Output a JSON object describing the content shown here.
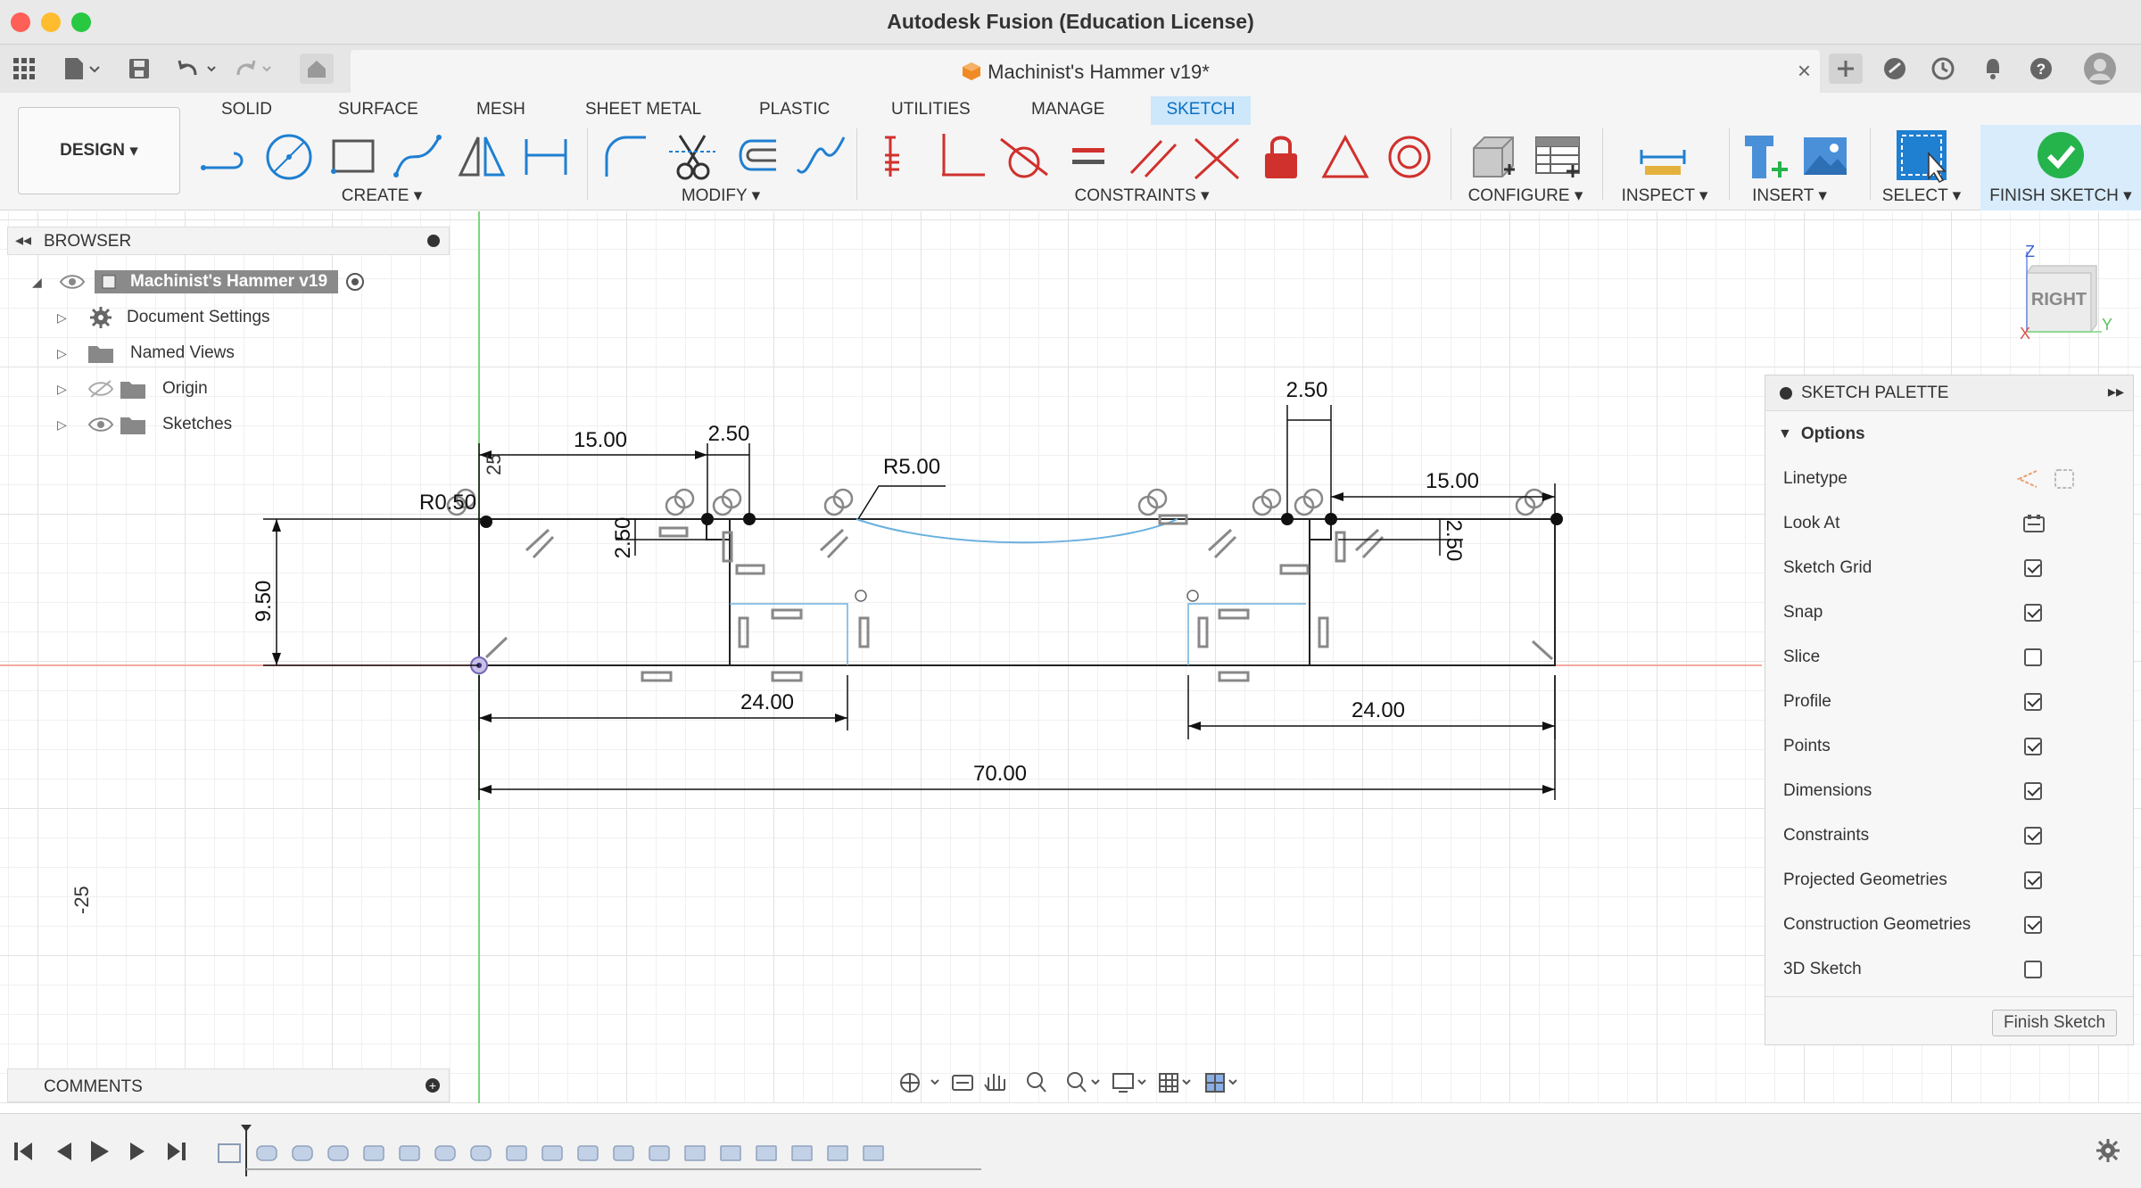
{
  "window": {
    "title": "Autodesk Fusion (Education License)"
  },
  "document_tab": {
    "title": "Machinist's Hammer v19*"
  },
  "workspace": {
    "label": "DESIGN"
  },
  "ribbon_tabs": [
    "SOLID",
    "SURFACE",
    "MESH",
    "SHEET METAL",
    "PLASTIC",
    "UTILITIES",
    "MANAGE",
    "SKETCH"
  ],
  "active_tab": "SKETCH",
  "groups": {
    "create": "CREATE",
    "modify": "MODIFY",
    "constraints": "CONSTRAINTS",
    "configure": "CONFIGURE",
    "inspect": "INSPECT",
    "insert": "INSERT",
    "select": "SELECT",
    "finish": "FINISH SKETCH"
  },
  "browser": {
    "title": "BROWSER",
    "root": "Machinist's Hammer v19",
    "items": [
      "Document Settings",
      "Named Views",
      "Origin",
      "Sketches"
    ]
  },
  "comments": {
    "title": "COMMENTS"
  },
  "viewcube": {
    "face": "RIGHT",
    "axis_z": "Z",
    "axis_y": "Y",
    "axis_x": "X"
  },
  "sketch": {
    "axis_labels": {
      "top": "25",
      "left": "-25"
    },
    "dimensions": {
      "d1": "15.00",
      "d2": "2.50",
      "d3": "R5.00",
      "d4": "2.50",
      "d5": "15.00",
      "d6": "R0.50",
      "d7": "9.50",
      "d8": "2.50",
      "d9": "2.50",
      "d10": "24.00",
      "d11": "24.00",
      "d12": "70.00"
    }
  },
  "palette": {
    "title": "SKETCH PALETTE",
    "section": "Options",
    "rows": [
      {
        "label": "Linetype",
        "type": "icons"
      },
      {
        "label": "Look At",
        "type": "icon"
      },
      {
        "label": "Sketch Grid",
        "type": "check",
        "checked": true
      },
      {
        "label": "Snap",
        "type": "check",
        "checked": true
      },
      {
        "label": "Slice",
        "type": "check",
        "checked": false
      },
      {
        "label": "Profile",
        "type": "check",
        "checked": true
      },
      {
        "label": "Points",
        "type": "check",
        "checked": true
      },
      {
        "label": "Dimensions",
        "type": "check",
        "checked": true
      },
      {
        "label": "Constraints",
        "type": "check",
        "checked": true
      },
      {
        "label": "Projected Geometries",
        "type": "check",
        "checked": true
      },
      {
        "label": "Construction Geometries",
        "type": "check",
        "checked": true
      },
      {
        "label": "3D Sketch",
        "type": "check",
        "checked": false
      }
    ],
    "finish_button": "Finish Sketch"
  },
  "colors": {
    "accent": "#0a6fc2",
    "sketch_line": "#222222",
    "curve": "#6ab0de",
    "constraint_red": "#d0312d",
    "finish_green": "#25b34b"
  }
}
